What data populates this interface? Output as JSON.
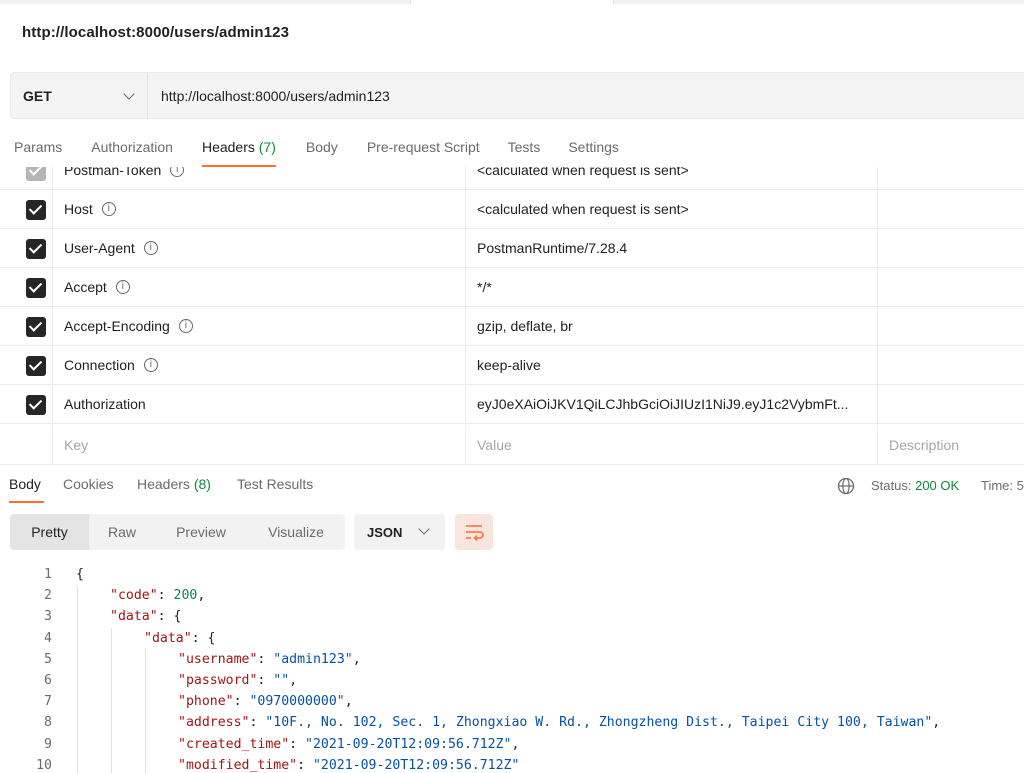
{
  "request": {
    "title": "http://localhost:8000/users/admin123",
    "method": "GET",
    "url": "http://localhost:8000/users/admin123"
  },
  "request_tabs": [
    {
      "label": "Params"
    },
    {
      "label": "Authorization"
    },
    {
      "label": "Headers",
      "count": "(7)",
      "active": true
    },
    {
      "label": "Body"
    },
    {
      "label": "Pre-request Script"
    },
    {
      "label": "Tests"
    },
    {
      "label": "Settings"
    }
  ],
  "headers": [
    {
      "key": "Postman-Token",
      "value": "<calculated when request is sent>",
      "checked": true,
      "info": true
    },
    {
      "key": "Host",
      "value": "<calculated when request is sent>",
      "checked": true,
      "info": true
    },
    {
      "key": "User-Agent",
      "value": "PostmanRuntime/7.28.4",
      "checked": true,
      "info": true
    },
    {
      "key": "Accept",
      "value": "*/*",
      "checked": true,
      "info": true
    },
    {
      "key": "Accept-Encoding",
      "value": "gzip, deflate, br",
      "checked": true,
      "info": true
    },
    {
      "key": "Connection",
      "value": "keep-alive",
      "checked": true,
      "info": true
    },
    {
      "key": "Authorization",
      "value": "eyJ0eXAiOiJKV1QiLCJhbGciOiJIUzI1NiJ9.eyJ1c2VybmFt...",
      "checked": true,
      "info": false
    }
  ],
  "headers_placeholder": {
    "key": "Key",
    "value": "Value",
    "description": "Description"
  },
  "response_tabs": [
    {
      "label": "Body",
      "active": true
    },
    {
      "label": "Cookies"
    },
    {
      "label": "Headers",
      "count": "(8)"
    },
    {
      "label": "Test Results"
    }
  ],
  "response_status": {
    "label": "Status:",
    "value": "200 OK",
    "time_label": "Time: 5"
  },
  "view_modes": [
    "Pretty",
    "Raw",
    "Preview",
    "Visualize"
  ],
  "active_view": "Pretty",
  "format": "JSON",
  "icons": {
    "info": "info-icon",
    "globe": "globe-icon",
    "wrap": "wrap-lines-icon",
    "chevron": "chevron-down-icon",
    "check": "checkbox-checked-icon"
  },
  "colors": {
    "accent": "#ff6c37",
    "success": "#0d8a3a",
    "json_key": "#a31515",
    "json_string": "#0451a5",
    "json_number": "#098658"
  },
  "response_body": [
    {
      "ln": "1",
      "indent": 0,
      "tokens": [
        {
          "t": "p",
          "v": "{"
        }
      ]
    },
    {
      "ln": "2",
      "indent": 1,
      "tokens": [
        {
          "t": "k",
          "v": "\"code\""
        },
        {
          "t": "p",
          "v": ": "
        },
        {
          "t": "n",
          "v": "200"
        },
        {
          "t": "p",
          "v": ","
        }
      ]
    },
    {
      "ln": "3",
      "indent": 1,
      "tokens": [
        {
          "t": "k",
          "v": "\"data\""
        },
        {
          "t": "p",
          "v": ": {"
        }
      ]
    },
    {
      "ln": "4",
      "indent": 2,
      "tokens": [
        {
          "t": "k",
          "v": "\"data\""
        },
        {
          "t": "p",
          "v": ": {"
        }
      ]
    },
    {
      "ln": "5",
      "indent": 3,
      "tokens": [
        {
          "t": "k",
          "v": "\"username\""
        },
        {
          "t": "p",
          "v": ": "
        },
        {
          "t": "s",
          "v": "\"admin123\""
        },
        {
          "t": "p",
          "v": ","
        }
      ]
    },
    {
      "ln": "6",
      "indent": 3,
      "tokens": [
        {
          "t": "k",
          "v": "\"password\""
        },
        {
          "t": "p",
          "v": ": "
        },
        {
          "t": "s",
          "v": "\"\""
        },
        {
          "t": "p",
          "v": ","
        }
      ]
    },
    {
      "ln": "7",
      "indent": 3,
      "tokens": [
        {
          "t": "k",
          "v": "\"phone\""
        },
        {
          "t": "p",
          "v": ": "
        },
        {
          "t": "s",
          "v": "\"0970000000\""
        },
        {
          "t": "p",
          "v": ","
        }
      ]
    },
    {
      "ln": "8",
      "indent": 3,
      "tokens": [
        {
          "t": "k",
          "v": "\"address\""
        },
        {
          "t": "p",
          "v": ": "
        },
        {
          "t": "s",
          "v": "\"10F., No. 102, Sec. 1, Zhongxiao W. Rd., Zhongzheng Dist., Taipei City 100, Taiwan\""
        },
        {
          "t": "p",
          "v": ","
        }
      ]
    },
    {
      "ln": "9",
      "indent": 3,
      "tokens": [
        {
          "t": "k",
          "v": "\"created_time\""
        },
        {
          "t": "p",
          "v": ": "
        },
        {
          "t": "s",
          "v": "\"2021-09-20T12:09:56.712Z\""
        },
        {
          "t": "p",
          "v": ","
        }
      ]
    },
    {
      "ln": "10",
      "indent": 3,
      "tokens": [
        {
          "t": "k",
          "v": "\"modified_time\""
        },
        {
          "t": "p",
          "v": ": "
        },
        {
          "t": "s",
          "v": "\"2021-09-20T12:09:56.712Z\""
        }
      ]
    }
  ]
}
